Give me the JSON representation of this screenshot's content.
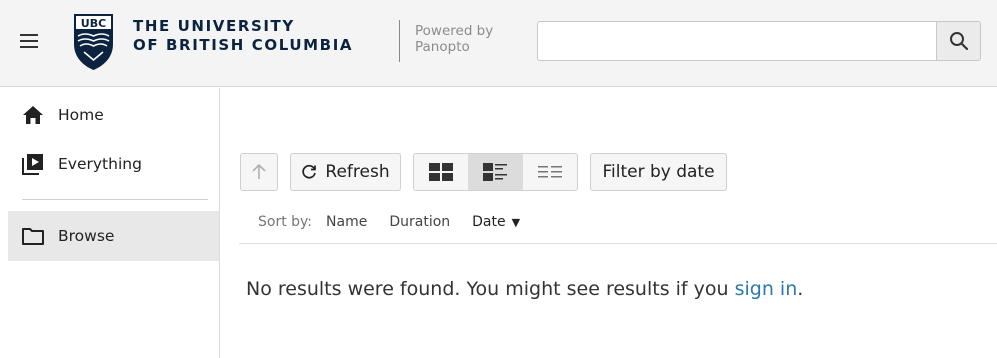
{
  "header": {
    "logo_abbrev": "UBC",
    "university_line1": "THE UNIVERSITY",
    "university_line2": "OF BRITISH COLUMBIA",
    "powered_line1": "Powered by",
    "powered_line2": "Panopto",
    "search": {
      "value": "",
      "placeholder": ""
    }
  },
  "sidebar": {
    "items": [
      {
        "label": "Home",
        "icon": "home-icon"
      },
      {
        "label": "Everything",
        "icon": "play-library-icon"
      },
      {
        "label": "Browse",
        "icon": "folder-icon",
        "selected": true
      }
    ]
  },
  "toolbar": {
    "refresh_label": "Refresh",
    "filter_label": "Filter by date",
    "views": [
      "thumbnail-view",
      "detail-view",
      "list-view"
    ],
    "active_view": "detail-view"
  },
  "sort": {
    "label": "Sort by:",
    "options": [
      "Name",
      "Duration",
      "Date"
    ],
    "selected": "Date"
  },
  "results": {
    "message": "No results were found. You might see results if you ",
    "link": "sign in",
    "suffix": "."
  },
  "colors": {
    "brand_navy": "#0c2340",
    "link": "#2a7ab0",
    "header_bg": "#f4f4f4"
  }
}
